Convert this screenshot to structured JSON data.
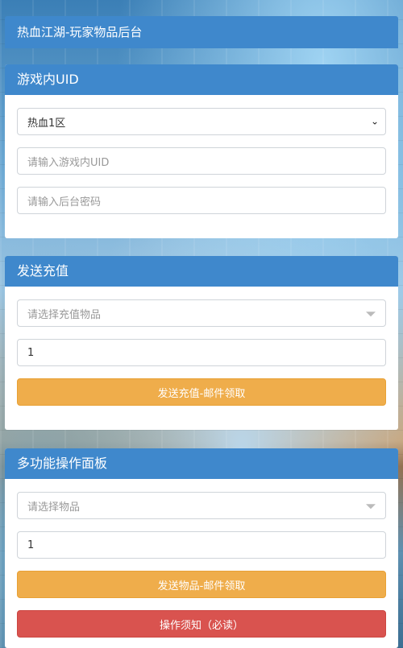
{
  "header": {
    "title": "热血江湖-玩家物品后台"
  },
  "panel_uid": {
    "title": "游戏内UID",
    "server_select": "热血1区",
    "uid_placeholder": "请输入游戏内UID",
    "password_placeholder": "请输入后台密码"
  },
  "panel_recharge": {
    "title": "发送充值",
    "item_placeholder": "请选择充值物品",
    "quantity": "1",
    "send_button": "发送充值-邮件领取"
  },
  "panel_multi": {
    "title": "多功能操作面板",
    "item_placeholder": "请选择物品",
    "quantity": "1",
    "send_button": "发送物品-邮件领取",
    "notice_button": "操作须知（必读）"
  }
}
